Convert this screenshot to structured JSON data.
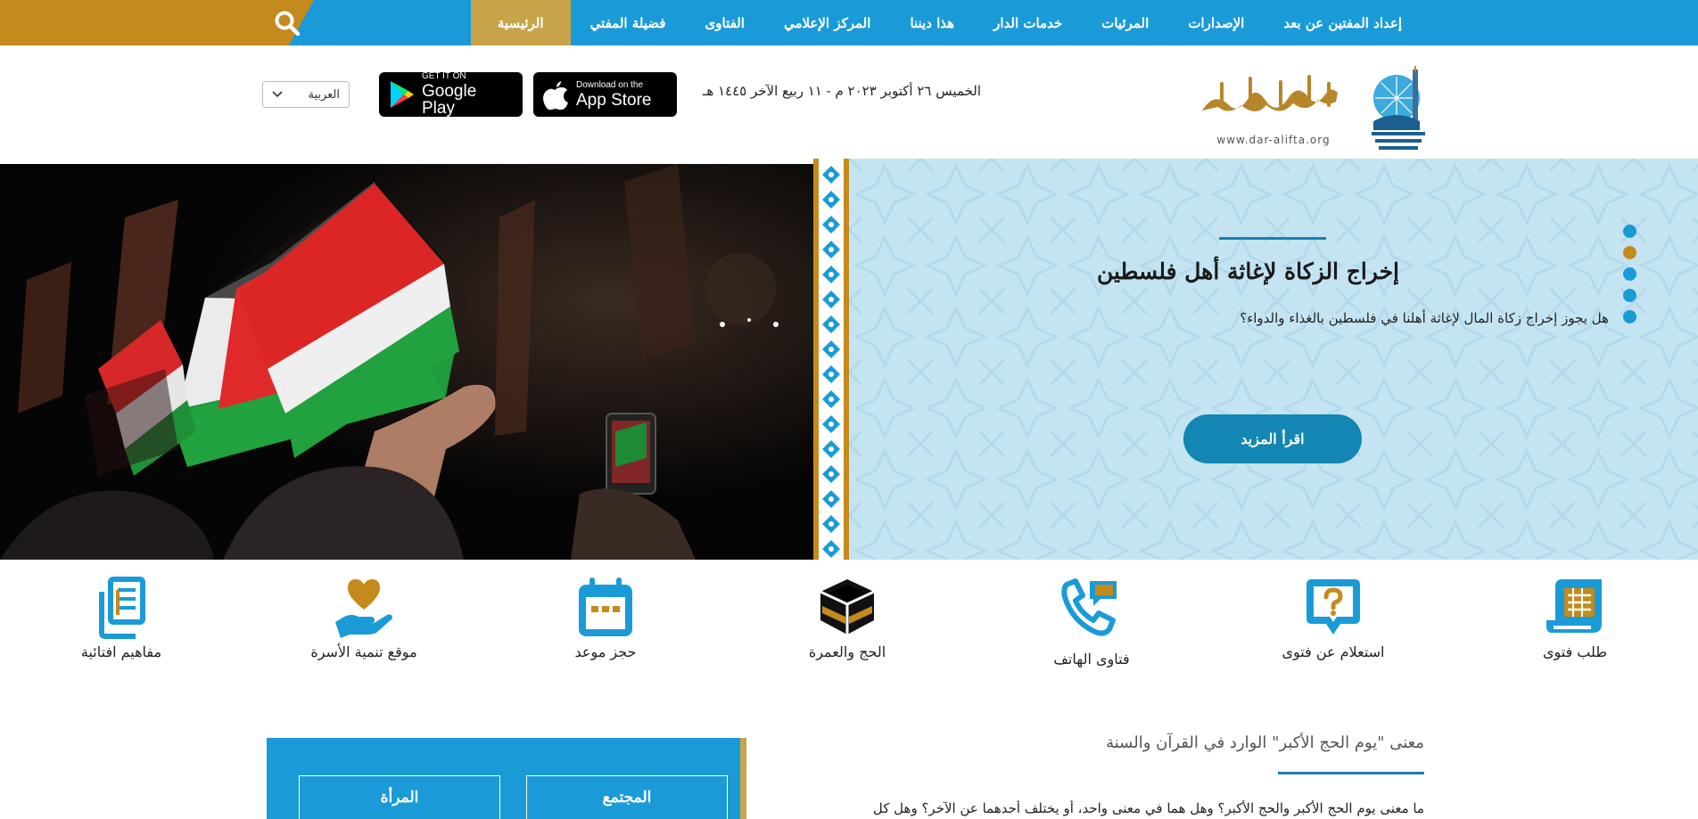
{
  "nav": {
    "search_icon": "search-icon",
    "items": [
      {
        "label": "الرئيسية",
        "active": true
      },
      {
        "label": "فضيلة المفتي"
      },
      {
        "label": "الفتاوى"
      },
      {
        "label": "المركز الإعلامي"
      },
      {
        "label": "هذا ديننا"
      },
      {
        "label": "خدمات الدار"
      },
      {
        "label": "المرئيات"
      },
      {
        "label": "الإصدارات"
      },
      {
        "label": "إعداد المفتين عن بعد"
      }
    ]
  },
  "header": {
    "logo_url_text": "www.dar-alifta.org",
    "date": "الخميس ٢٦ أكتوبر ٢٠٢٣ م - ١١ ربيع الآخر ١٤٤٥ هـ",
    "app_store": {
      "small": "Download on the",
      "big": "App Store"
    },
    "google_play": {
      "small": "GET IT ON",
      "big": "Google Play"
    },
    "language": "العربية"
  },
  "hero": {
    "title": "إخراج الزكاة لإغاثة أهل فلسطين",
    "question": "هل يجوز إخراج زكاة المال لإغاثة أهلنا في فلسطين بالغذاء والدواء؟",
    "button": "اقرأ المزيد",
    "slides": 5,
    "active_slide": 2
  },
  "quick_links": [
    {
      "label": "طلب فتوى",
      "icon": "document-list-icon"
    },
    {
      "label": "استعلام عن فتوى",
      "icon": "question-bubble-icon"
    },
    {
      "label": "فتاوى الهاتف",
      "icon": "phone-chat-icon"
    },
    {
      "label": "الحج والعمرة",
      "icon": "kaaba-icon"
    },
    {
      "label": "حجز موعد",
      "icon": "calendar-icon"
    },
    {
      "label": "موقع تنمية الأسرة",
      "icon": "heart-hand-icon"
    },
    {
      "label": "مفاهيم افتائية",
      "icon": "documents-icon"
    }
  ],
  "categories": {
    "items": [
      "المجتمع",
      "المرأة"
    ]
  },
  "article": {
    "title": "معنى \"يوم الحج الأكبر\" الوارد في القرآن والسنة",
    "excerpt": "ما معنى يوم الحج الأكبر والحج الأكبر؟ وهل هما في معنى واحد، أو يختلف أحدهما عن الآخر؟ وهل كل"
  },
  "colors": {
    "nav_blue": "#1a9bd7",
    "gold": "#c48a1c",
    "active_tab": "#c7a44a",
    "hero_panel": "#c5e4f2",
    "button_blue": "#1386b3"
  }
}
